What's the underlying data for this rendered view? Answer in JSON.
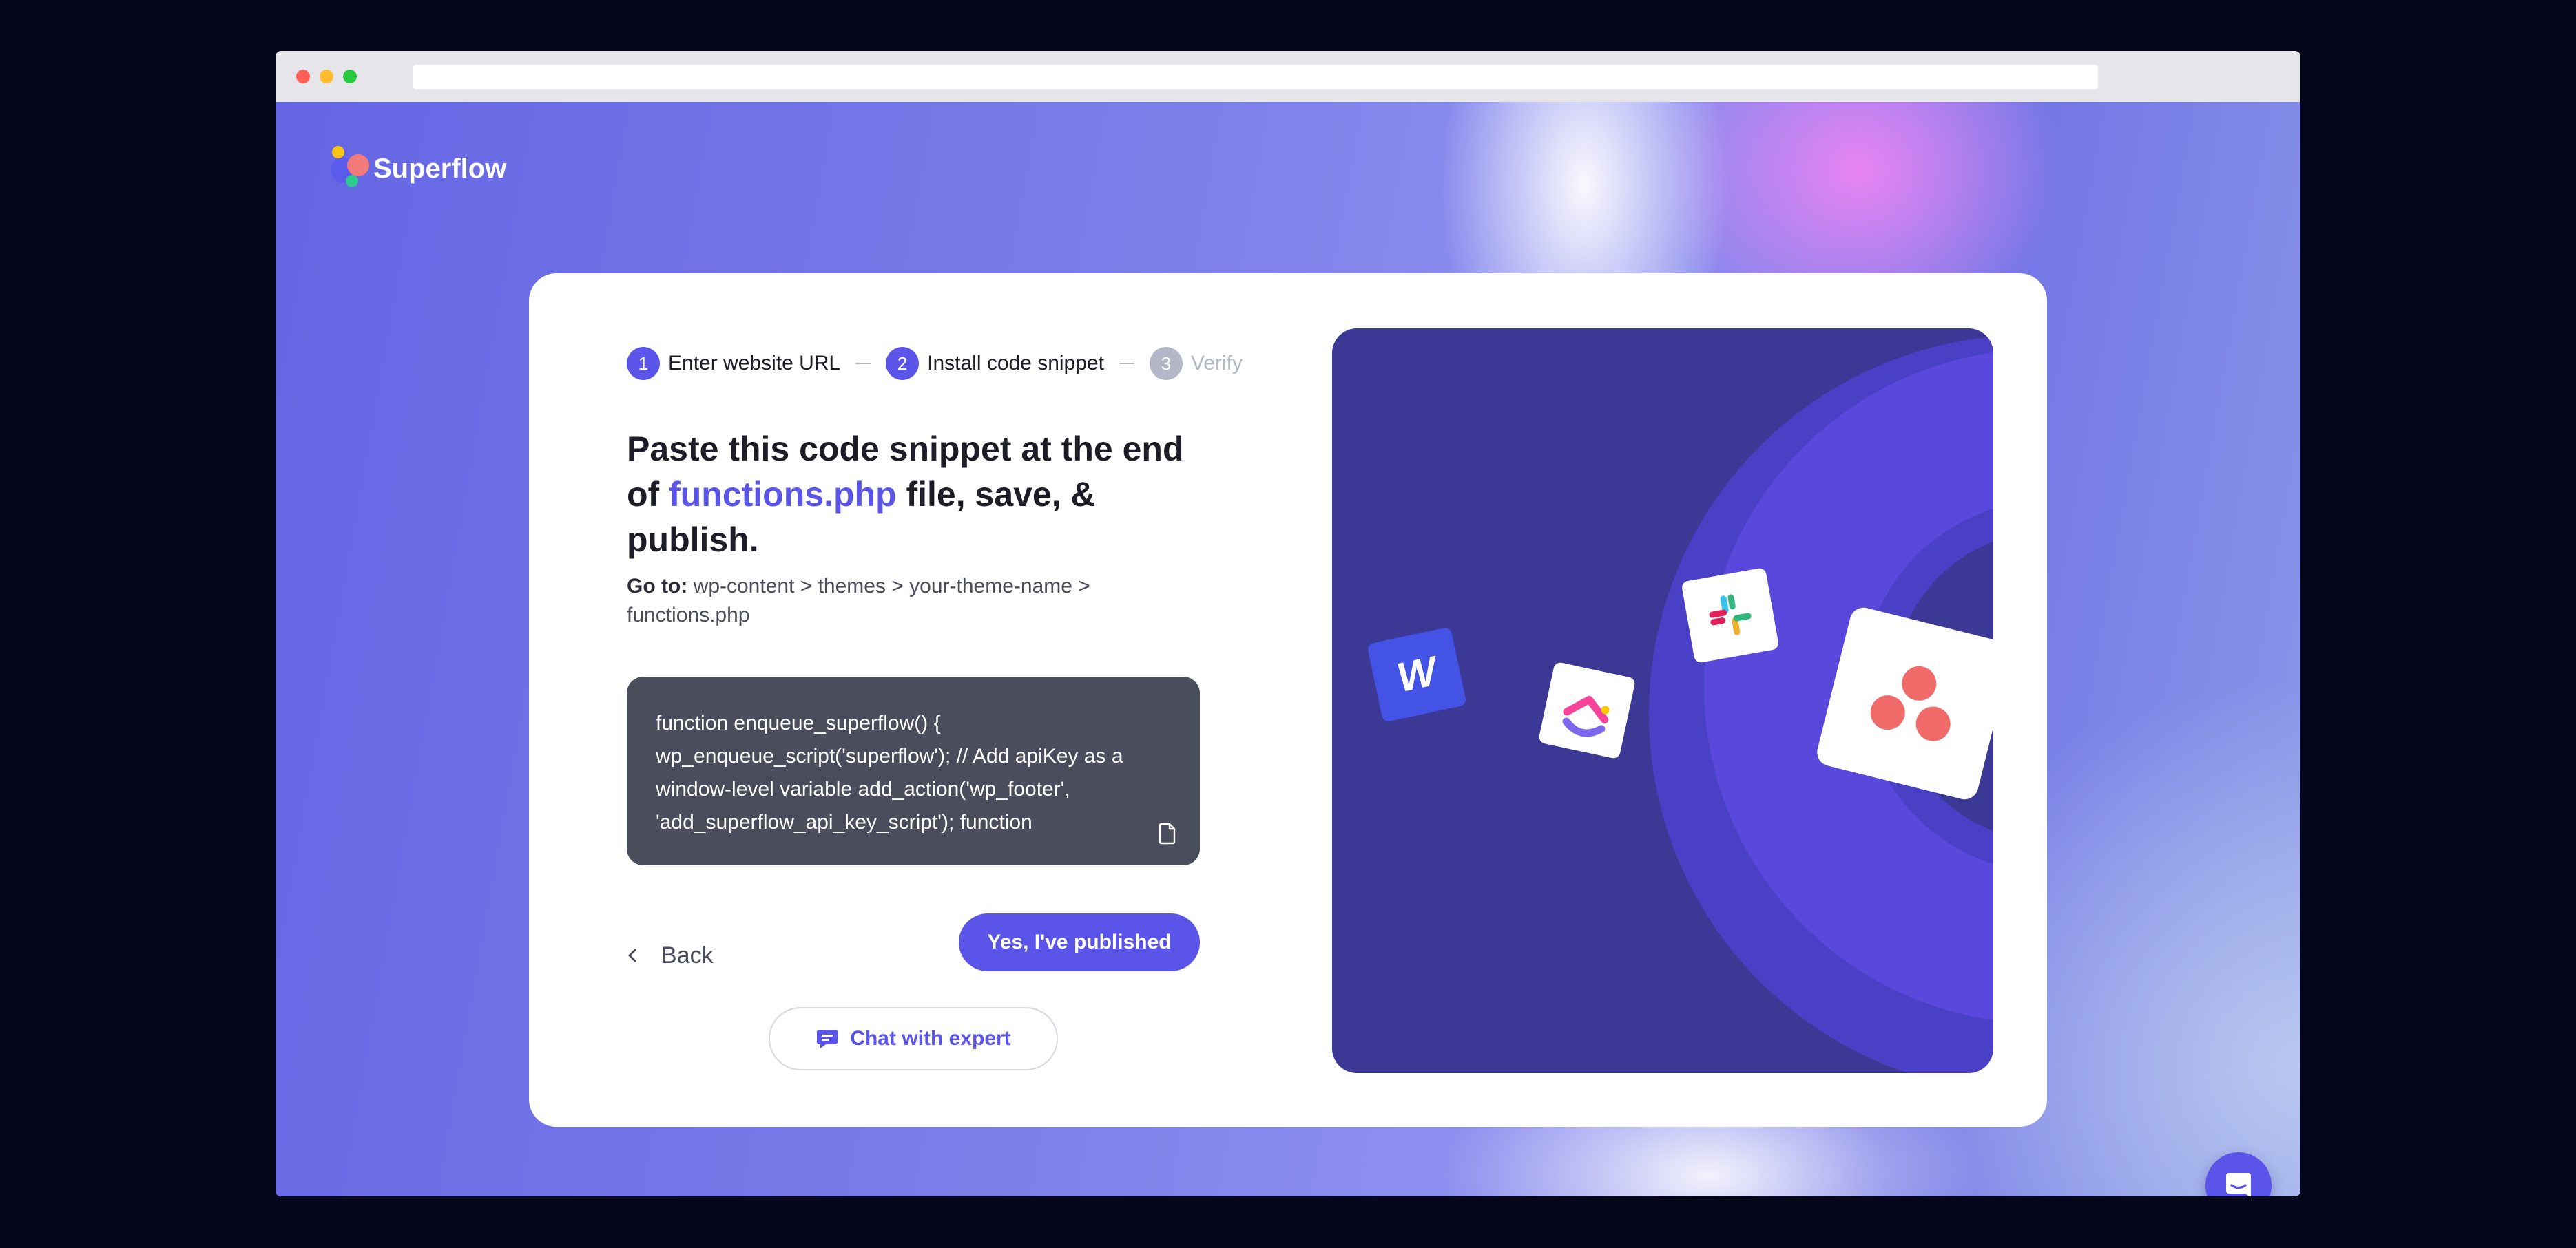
{
  "brand": {
    "name": "Superflow"
  },
  "steps": [
    {
      "num": "1",
      "label": "Enter website URL",
      "state": "done"
    },
    {
      "num": "2",
      "label": "Install code snippet",
      "state": "active"
    },
    {
      "num": "3",
      "label": "Verify",
      "state": "pending"
    }
  ],
  "headline": {
    "before": "Paste this code snippet at the end of ",
    "highlight": "functions.php",
    "after": " file, save, & publish."
  },
  "goto": {
    "label": "Go to:",
    "path": "wp-content > themes > your-theme-name > functions.php"
  },
  "code": {
    "snippet": "function enqueue_superflow() { wp_enqueue_script('superflow'); // Add apiKey as a window-level variable add_action('wp_footer', 'add_superflow_api_key_script'); function"
  },
  "actions": {
    "back_label": "Back",
    "publish_label": "Yes, I've published",
    "chat_label": "Chat with expert"
  },
  "colors": {
    "accent": "#5a55e8",
    "illustration_bg": "#3c3895",
    "code_bg": "#4a4d5c"
  },
  "icons": [
    "copy-icon",
    "chevron-left-icon",
    "chat-bubble-icon",
    "webflow-icon",
    "clickup-icon",
    "slack-icon",
    "asana-icon",
    "messenger-icon"
  ]
}
